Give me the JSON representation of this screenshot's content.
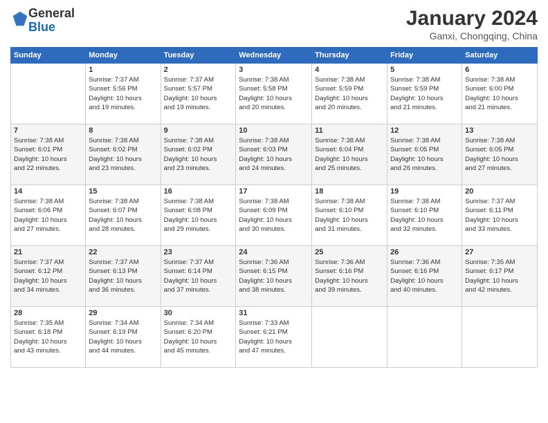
{
  "logo": {
    "general": "General",
    "blue": "Blue"
  },
  "title": "January 2024",
  "location": "Ganxi, Chongqing, China",
  "days_of_week": [
    "Sunday",
    "Monday",
    "Tuesday",
    "Wednesday",
    "Thursday",
    "Friday",
    "Saturday"
  ],
  "weeks": [
    [
      {
        "day": "",
        "info": ""
      },
      {
        "day": "1",
        "info": "Sunrise: 7:37 AM\nSunset: 5:56 PM\nDaylight: 10 hours\nand 19 minutes."
      },
      {
        "day": "2",
        "info": "Sunrise: 7:37 AM\nSunset: 5:57 PM\nDaylight: 10 hours\nand 19 minutes."
      },
      {
        "day": "3",
        "info": "Sunrise: 7:38 AM\nSunset: 5:58 PM\nDaylight: 10 hours\nand 20 minutes."
      },
      {
        "day": "4",
        "info": "Sunrise: 7:38 AM\nSunset: 5:59 PM\nDaylight: 10 hours\nand 20 minutes."
      },
      {
        "day": "5",
        "info": "Sunrise: 7:38 AM\nSunset: 5:59 PM\nDaylight: 10 hours\nand 21 minutes."
      },
      {
        "day": "6",
        "info": "Sunrise: 7:38 AM\nSunset: 6:00 PM\nDaylight: 10 hours\nand 21 minutes."
      }
    ],
    [
      {
        "day": "7",
        "info": "Sunrise: 7:38 AM\nSunset: 6:01 PM\nDaylight: 10 hours\nand 22 minutes."
      },
      {
        "day": "8",
        "info": "Sunrise: 7:38 AM\nSunset: 6:02 PM\nDaylight: 10 hours\nand 23 minutes."
      },
      {
        "day": "9",
        "info": "Sunrise: 7:38 AM\nSunset: 6:02 PM\nDaylight: 10 hours\nand 23 minutes."
      },
      {
        "day": "10",
        "info": "Sunrise: 7:38 AM\nSunset: 6:03 PM\nDaylight: 10 hours\nand 24 minutes."
      },
      {
        "day": "11",
        "info": "Sunrise: 7:38 AM\nSunset: 6:04 PM\nDaylight: 10 hours\nand 25 minutes."
      },
      {
        "day": "12",
        "info": "Sunrise: 7:38 AM\nSunset: 6:05 PM\nDaylight: 10 hours\nand 26 minutes."
      },
      {
        "day": "13",
        "info": "Sunrise: 7:38 AM\nSunset: 6:05 PM\nDaylight: 10 hours\nand 27 minutes."
      }
    ],
    [
      {
        "day": "14",
        "info": "Sunrise: 7:38 AM\nSunset: 6:06 PM\nDaylight: 10 hours\nand 27 minutes."
      },
      {
        "day": "15",
        "info": "Sunrise: 7:38 AM\nSunset: 6:07 PM\nDaylight: 10 hours\nand 28 minutes."
      },
      {
        "day": "16",
        "info": "Sunrise: 7:38 AM\nSunset: 6:08 PM\nDaylight: 10 hours\nand 29 minutes."
      },
      {
        "day": "17",
        "info": "Sunrise: 7:38 AM\nSunset: 6:09 PM\nDaylight: 10 hours\nand 30 minutes."
      },
      {
        "day": "18",
        "info": "Sunrise: 7:38 AM\nSunset: 6:10 PM\nDaylight: 10 hours\nand 31 minutes."
      },
      {
        "day": "19",
        "info": "Sunrise: 7:38 AM\nSunset: 6:10 PM\nDaylight: 10 hours\nand 32 minutes."
      },
      {
        "day": "20",
        "info": "Sunrise: 7:37 AM\nSunset: 6:11 PM\nDaylight: 10 hours\nand 33 minutes."
      }
    ],
    [
      {
        "day": "21",
        "info": "Sunrise: 7:37 AM\nSunset: 6:12 PM\nDaylight: 10 hours\nand 34 minutes."
      },
      {
        "day": "22",
        "info": "Sunrise: 7:37 AM\nSunset: 6:13 PM\nDaylight: 10 hours\nand 36 minutes."
      },
      {
        "day": "23",
        "info": "Sunrise: 7:37 AM\nSunset: 6:14 PM\nDaylight: 10 hours\nand 37 minutes."
      },
      {
        "day": "24",
        "info": "Sunrise: 7:36 AM\nSunset: 6:15 PM\nDaylight: 10 hours\nand 38 minutes."
      },
      {
        "day": "25",
        "info": "Sunrise: 7:36 AM\nSunset: 6:16 PM\nDaylight: 10 hours\nand 39 minutes."
      },
      {
        "day": "26",
        "info": "Sunrise: 7:36 AM\nSunset: 6:16 PM\nDaylight: 10 hours\nand 40 minutes."
      },
      {
        "day": "27",
        "info": "Sunrise: 7:35 AM\nSunset: 6:17 PM\nDaylight: 10 hours\nand 42 minutes."
      }
    ],
    [
      {
        "day": "28",
        "info": "Sunrise: 7:35 AM\nSunset: 6:18 PM\nDaylight: 10 hours\nand 43 minutes."
      },
      {
        "day": "29",
        "info": "Sunrise: 7:34 AM\nSunset: 6:19 PM\nDaylight: 10 hours\nand 44 minutes."
      },
      {
        "day": "30",
        "info": "Sunrise: 7:34 AM\nSunset: 6:20 PM\nDaylight: 10 hours\nand 45 minutes."
      },
      {
        "day": "31",
        "info": "Sunrise: 7:33 AM\nSunset: 6:21 PM\nDaylight: 10 hours\nand 47 minutes."
      },
      {
        "day": "",
        "info": ""
      },
      {
        "day": "",
        "info": ""
      },
      {
        "day": "",
        "info": ""
      }
    ]
  ]
}
